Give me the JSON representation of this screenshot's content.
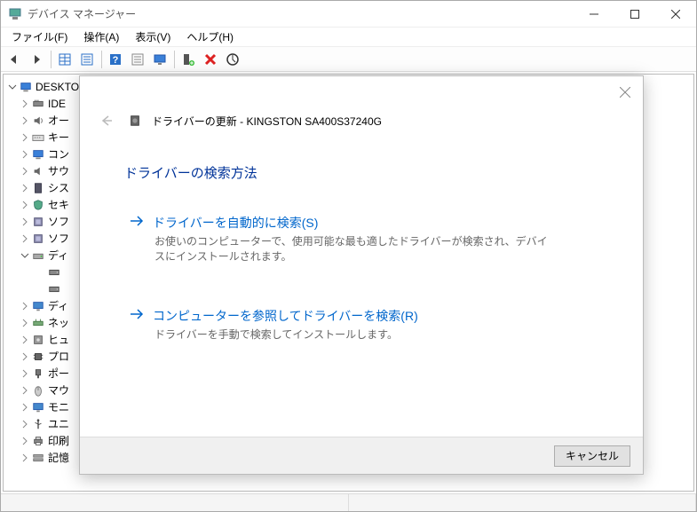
{
  "titlebar": {
    "title": "デバイス マネージャー"
  },
  "menubar": {
    "items": [
      {
        "label": "ファイル(F)"
      },
      {
        "label": "操作(A)"
      },
      {
        "label": "表示(V)"
      },
      {
        "label": "ヘルプ(H)"
      }
    ]
  },
  "toolbar": {
    "icons": [
      "back-arrow-icon",
      "forward-arrow-icon",
      "table-icon",
      "properties-icon",
      "help-icon",
      "list-icon",
      "monitor-icon",
      "device-add-icon",
      "delete-icon",
      "scan-icon"
    ]
  },
  "tree": {
    "root": {
      "label": "DESKTO",
      "expanded": true
    },
    "items": [
      {
        "icon": "ide-icon",
        "label": "IDE",
        "expander": "right"
      },
      {
        "icon": "audio-icon",
        "label": "オー",
        "expander": "right"
      },
      {
        "icon": "keyboard-icon",
        "label": "キー",
        "expander": "right"
      },
      {
        "icon": "computer-icon",
        "label": "コン",
        "expander": "right"
      },
      {
        "icon": "sound-icon",
        "label": "サウ",
        "expander": "right"
      },
      {
        "icon": "system-icon",
        "label": "シス",
        "expander": "right"
      },
      {
        "icon": "security-icon",
        "label": "セキ",
        "expander": "right"
      },
      {
        "icon": "software-icon",
        "label": "ソフ",
        "expander": "right"
      },
      {
        "icon": "software-icon",
        "label": "ソフ",
        "expander": "right"
      },
      {
        "icon": "disk-icon",
        "label": "ディ",
        "expander": "down"
      },
      {
        "icon": "drive-icon",
        "label": "",
        "expander": "none",
        "indent": 1
      },
      {
        "icon": "drive-icon",
        "label": "",
        "expander": "none",
        "indent": 1
      },
      {
        "icon": "display-icon",
        "label": "ディ",
        "expander": "right"
      },
      {
        "icon": "network-icon",
        "label": "ネッ",
        "expander": "right"
      },
      {
        "icon": "hid-icon",
        "label": "ヒュ",
        "expander": "right"
      },
      {
        "icon": "processor-icon",
        "label": "プロ",
        "expander": "right"
      },
      {
        "icon": "port-icon",
        "label": "ポー",
        "expander": "right"
      },
      {
        "icon": "mouse-icon",
        "label": "マウ",
        "expander": "right"
      },
      {
        "icon": "monitor-icon",
        "label": "モニ",
        "expander": "right"
      },
      {
        "icon": "usb-icon",
        "label": "ユニ",
        "expander": "right"
      },
      {
        "icon": "printer-icon",
        "label": "印刷",
        "expander": "right"
      },
      {
        "icon": "storage-icon",
        "label": "記憶",
        "expander": "right"
      }
    ]
  },
  "dialog": {
    "title_prefix": "ドライバーの更新 - ",
    "device_name": "KINGSTON SA400S37240G",
    "heading": "ドライバーの検索方法",
    "option1": {
      "title": "ドライバーを自動的に検索(S)",
      "desc": "お使いのコンピューターで、使用可能な最も適したドライバーが検索され、デバイスにインストールされます。"
    },
    "option2": {
      "title": "コンピューターを参照してドライバーを検索(R)",
      "desc": "ドライバーを手動で検索してインストールします。"
    },
    "cancel": "キャンセル"
  }
}
